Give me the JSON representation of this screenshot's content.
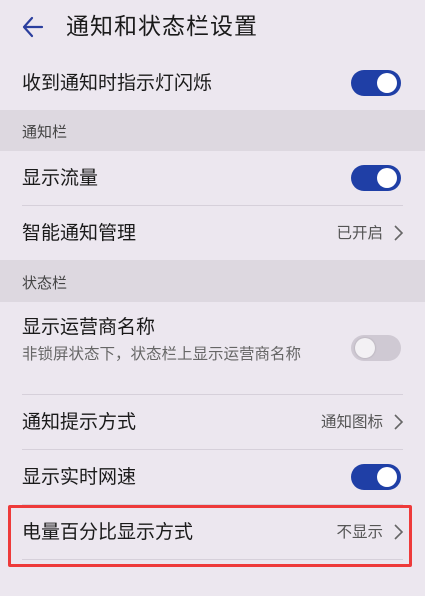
{
  "header": {
    "back_icon": "back-arrow-icon",
    "title": "通知和状态栏设置"
  },
  "rows": {
    "notify_light": {
      "label": "收到通知时指示灯闪烁",
      "toggle": "on"
    },
    "section_notification": "通知栏",
    "show_traffic": {
      "label": "显示流量",
      "toggle": "on"
    },
    "smart_notify": {
      "label": "智能通知管理",
      "value": "已开启"
    },
    "section_statusbar": "状态栏",
    "carrier_name": {
      "label": "显示运营商名称",
      "sub": "非锁屏状态下，状态栏上显示运营商名称",
      "toggle": "off"
    },
    "notify_style": {
      "label": "通知提示方式",
      "value": "通知图标"
    },
    "net_speed": {
      "label": "显示实时网速",
      "toggle": "on"
    },
    "battery_percent": {
      "label": "电量百分比显示方式",
      "value": "不显示"
    }
  },
  "colors": {
    "accent": "#1f3fa6",
    "background": "#ece7ef",
    "section_bg": "#ddd8e0",
    "highlight": "#ee3a3a"
  }
}
